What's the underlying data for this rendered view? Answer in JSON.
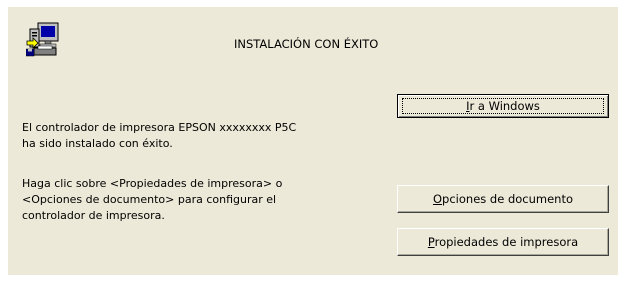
{
  "dialog": {
    "title": "INSTALACIÓN CON ÉXITO",
    "icon": "computer-printer-setup-icon",
    "message_line1": "El controlador de impresora EPSON xxxxxxxx P5C",
    "message_line2": "ha sido instalado con éxito.",
    "instruction_line1": "Haga clic sobre <Propiedades de impresora> o",
    "instruction_line2": "<Opciones de documento> para configurar el",
    "instruction_line3": "controlador de impresora."
  },
  "buttons": {
    "go_windows": {
      "mnemonic": "I",
      "rest": "r a Windows"
    },
    "document_options": {
      "mnemonic": "O",
      "rest": "pciones de documento"
    },
    "printer_properties": {
      "mnemonic": "P",
      "rest": "ropiedades de impresora"
    }
  },
  "colors": {
    "dialog_bg": "#ece9d8",
    "page_bg": "#ffffff",
    "text": "#000000"
  }
}
